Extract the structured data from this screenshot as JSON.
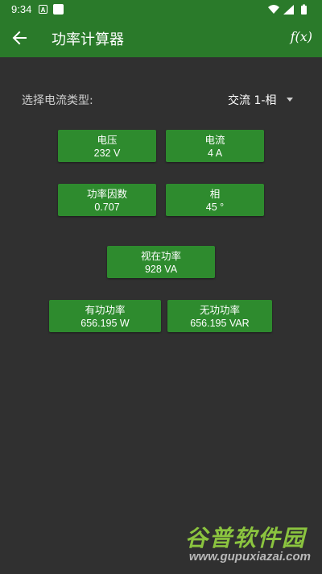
{
  "status_bar": {
    "time": "9:34",
    "a_icon_letter": "A",
    "icons": [
      "a-notification-icon",
      "square-notification-icon",
      "wifi-icon",
      "signal-icon",
      "battery-icon"
    ]
  },
  "app_bar": {
    "title": "功率计算器",
    "fx_label": "f(x)",
    "back_icon": "arrow-left-icon"
  },
  "selector": {
    "label": "选择电流类型:",
    "value": "交流 1-相"
  },
  "tiles": {
    "voltage": {
      "label": "电压",
      "value": "232 V"
    },
    "current": {
      "label": "电流",
      "value": "4 A"
    },
    "power_factor": {
      "label": "功率因数",
      "value": "0.707"
    },
    "phase": {
      "label": "相",
      "value": "45 °"
    },
    "apparent_power": {
      "label": "视在功率",
      "value": "928 VA"
    },
    "active_power": {
      "label": "有功功率",
      "value": "656.195 W"
    },
    "reactive_power": {
      "label": "无功功率",
      "value": "656.195 VAR"
    }
  },
  "watermark": {
    "title": "谷普软件园",
    "url": "www.gupuxiazai.com"
  },
  "colors": {
    "app_bar": "#2a7a2a",
    "tile": "#2e8b2e",
    "background": "#303030",
    "watermark_green": "#8bc43f"
  }
}
